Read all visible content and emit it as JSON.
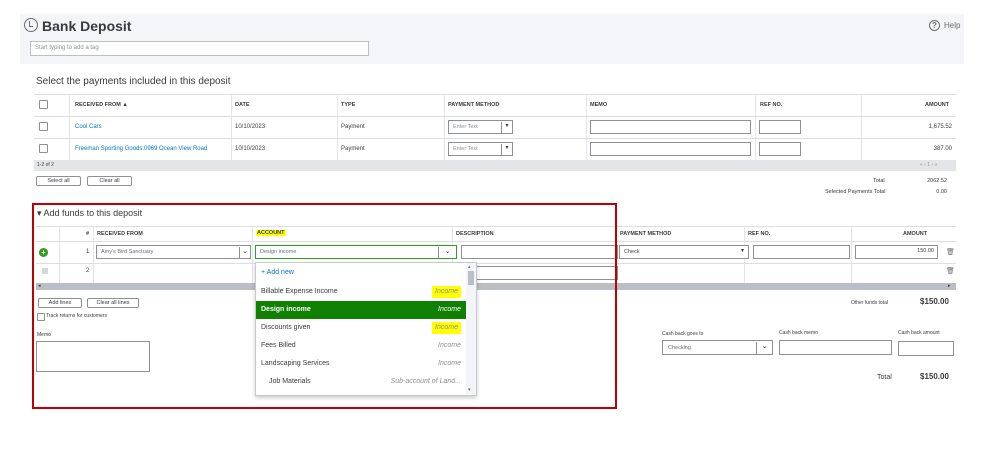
{
  "header": {
    "title": "Bank Deposit",
    "help_label": "Help",
    "help_glyph": "?",
    "tag_placeholder": "Start typing to add a tag"
  },
  "payments": {
    "section_title": "Select the payments included in this deposit",
    "columns": {
      "received_from": "RECEIVED FROM ▲",
      "date": "DATE",
      "type": "TYPE",
      "payment_method": "PAYMENT METHOD",
      "memo": "MEMO",
      "ref_no": "REF NO.",
      "amount": "AMOUNT"
    },
    "rows": [
      {
        "received_from": "Cool Cars",
        "date": "10/10/2023",
        "type": "Payment",
        "method_placeholder": "Enter Text",
        "amount": "1,675.52"
      },
      {
        "received_from": "Freeman Sporting Goods:0969 Ocean View Road",
        "date": "10/10/2023",
        "type": "Payment",
        "method_placeholder": "Enter Text",
        "amount": "387.00"
      }
    ],
    "pager_count": "1-2 of 2",
    "pager_nav": "« ‹ 1 › »",
    "select_all": "Select all",
    "clear_all": "Clear all",
    "total_label": "Total",
    "total_value": "2062.52",
    "selected_label": "Selected Payments Total",
    "selected_value": "0.00"
  },
  "funds": {
    "section_title": "Add funds to this deposit",
    "columns": {
      "num": "#",
      "received_from": "RECEIVED FROM",
      "account": "ACCOUNT",
      "description": "DESCRIPTION",
      "payment_method": "PAYMENT METHOD",
      "ref_no": "REF NO.",
      "amount": "AMOUNT"
    },
    "row1": {
      "num": "1",
      "received_from": "Amy's Bird Sanctuary",
      "account": "Design income",
      "payment_method": "Check",
      "amount": "150.00"
    },
    "row2": {
      "num": "2"
    },
    "add_lines": "Add lines",
    "clear_all_lines": "Clear all lines",
    "track_returns": "Track returns for customers",
    "other_funds_label": "Other funds total",
    "other_funds_value": "$150.00",
    "memo_label": "Memo",
    "cash_back_goes_to_label": "Cash back goes to",
    "cash_back_goes_to_value": "Checking",
    "cash_back_memo_label": "Cash back memo",
    "cash_back_amount_label": "Cash back amount",
    "total_label": "Total",
    "total_value": "$150.00"
  },
  "account_dropdown": {
    "add_new": "+ Add new",
    "items": [
      {
        "name": "Billable Expense Income",
        "type": "Income",
        "highlighted": true,
        "selected": false
      },
      {
        "name": "Design income",
        "type": "Income",
        "highlighted": false,
        "selected": true
      },
      {
        "name": "Discounts given",
        "type": "Income",
        "highlighted": true,
        "selected": false
      },
      {
        "name": "Fees Billed",
        "type": "Income",
        "highlighted": false,
        "selected": false
      },
      {
        "name": "Landscaping Services",
        "type": "Income",
        "highlighted": false,
        "selected": false
      },
      {
        "name": "Job Materials",
        "type": "Sub-account of Land...",
        "highlighted": false,
        "selected": false
      }
    ]
  },
  "colors": {
    "accent_green": "#108000",
    "link_blue": "#0077c5",
    "annotation_red": "#c00000",
    "highlight_yellow": "#ffff00"
  }
}
